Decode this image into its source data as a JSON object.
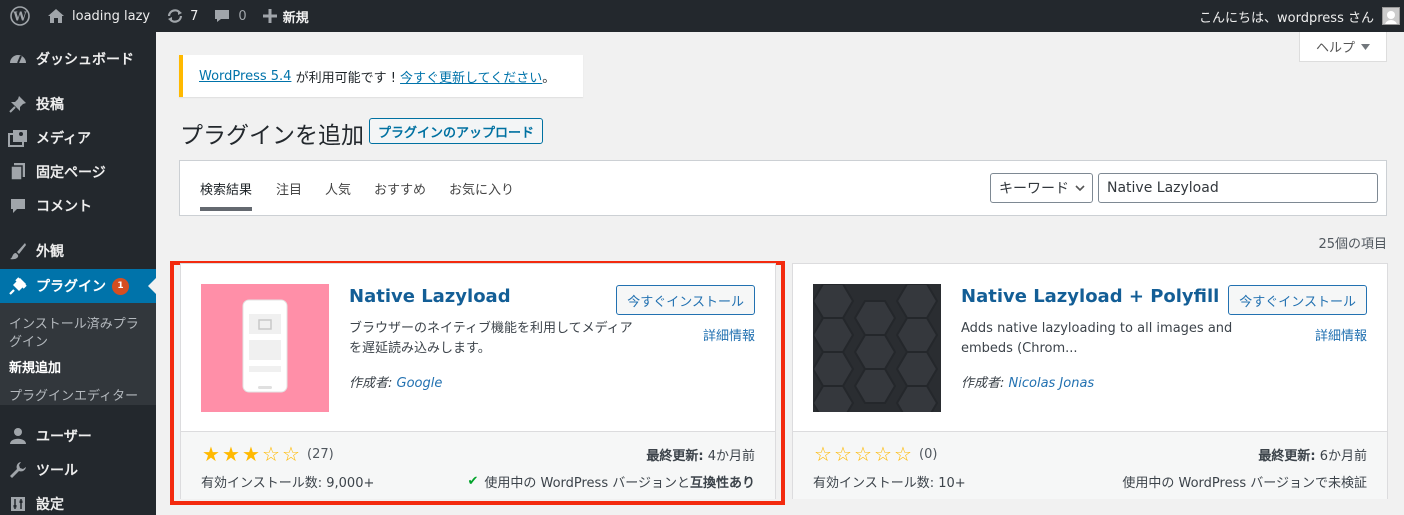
{
  "adminbar": {
    "site_name": "loading lazy",
    "updates_count": "7",
    "comments_count": "0",
    "new_label": "新規",
    "greeting": "こんにちは、wordpress さん"
  },
  "sidebar": {
    "items": [
      {
        "label": "ダッシュボード",
        "icon": "dashboard-icon"
      },
      {
        "label": "投稿",
        "icon": "pin-icon"
      },
      {
        "label": "メディア",
        "icon": "media-icon"
      },
      {
        "label": "固定ページ",
        "icon": "page-icon"
      },
      {
        "label": "コメント",
        "icon": "comment-icon"
      },
      {
        "label": "外観",
        "icon": "brush-icon"
      },
      {
        "label": "プラグイン",
        "icon": "plugin-icon",
        "badge": "1"
      },
      {
        "label": "ユーザー",
        "icon": "user-icon"
      },
      {
        "label": "ツール",
        "icon": "wrench-icon"
      },
      {
        "label": "設定",
        "icon": "settings-icon"
      }
    ],
    "submenu": [
      "インストール済みプラグイン",
      "新規追加",
      "プラグインエディター"
    ]
  },
  "help_label": "ヘルプ",
  "notice": {
    "link1": "WordPress 5.4",
    "text": " が利用可能です ! ",
    "link2": "今すぐ更新してください",
    "end": "。"
  },
  "page_title": "プラグインを追加",
  "upload_button": "プラグインのアップロード",
  "filter": {
    "tabs": [
      "検索結果",
      "注目",
      "人気",
      "おすすめ",
      "お気に入り"
    ],
    "search_type": "キーワード",
    "search_value": "Native Lazyload"
  },
  "result_count": "25個の項目",
  "cards": [
    {
      "name": "Native Lazyload",
      "install_label": "今すぐインストール",
      "details_label": "詳細情報",
      "description": "ブラウザーのネイティブ機能を利用してメディアを遅延読み込みします。",
      "author_prefix": "作成者: ",
      "author": "Google",
      "rating_stars": 3,
      "rating_count": "(27)",
      "updated_label": "最終更新:",
      "updated_value": " 4か月前",
      "installs": "有効インストール数: 9,000+",
      "compat_prefix": "使用中の WordPress バージョンと",
      "compat_strong": "互換性あり",
      "thumb_color": "#ff8fa8"
    },
    {
      "name": "Native Lazyload + Polyfill",
      "install_label": "今すぐインストール",
      "details_label": "詳細情報",
      "description": "Adds native lazyloading to all images and embeds (Chrom...",
      "author_prefix": "作成者: ",
      "author": "Nicolas Jonas",
      "rating_stars": 0,
      "rating_count": "(0)",
      "updated_label": "最終更新:",
      "updated_value": " 6か月前",
      "installs": "有効インストール数: 10+",
      "compat_prefix": "使用中の WordPress バージョンで未検証",
      "compat_strong": "",
      "thumb_color": "#2a2d31"
    }
  ],
  "colors": {
    "adminbar_bg": "#23282d",
    "accent": "#0073aa",
    "highlight_border": "#f32a0e",
    "star": "#ffb900"
  }
}
